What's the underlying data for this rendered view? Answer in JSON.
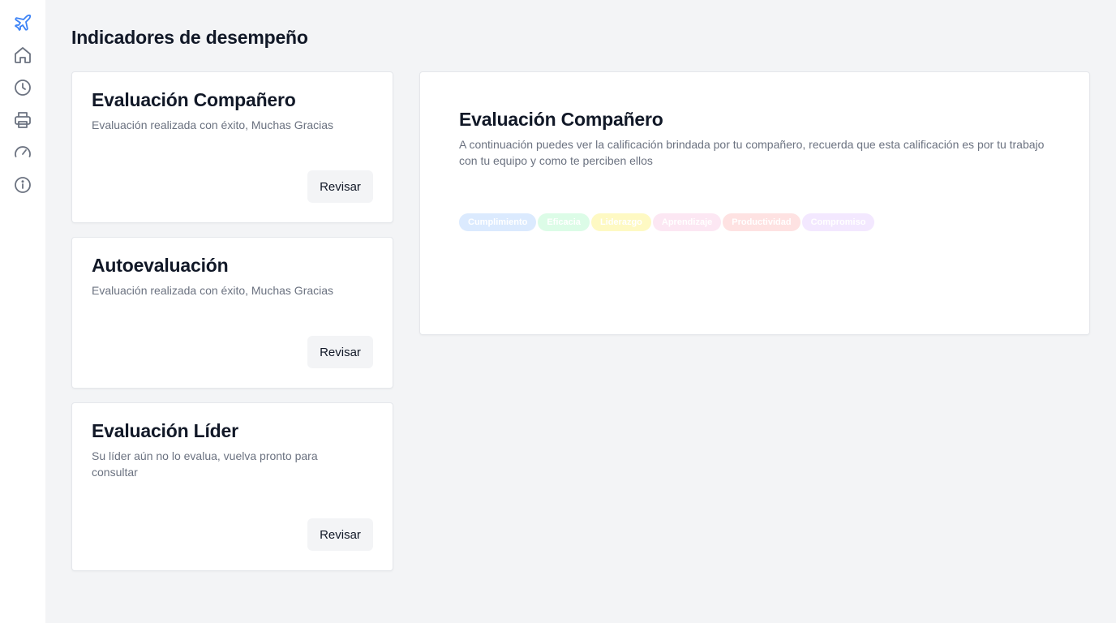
{
  "page": {
    "title": "Indicadores de desempeño"
  },
  "sidebar": {
    "items": [
      {
        "icon": "airplane-icon",
        "active": true
      },
      {
        "icon": "home-icon"
      },
      {
        "icon": "clock-icon"
      },
      {
        "icon": "printer-icon"
      },
      {
        "icon": "gauge-icon"
      },
      {
        "icon": "info-icon"
      }
    ],
    "active_color": "#3b82f6",
    "icon_color": "#6b7280"
  },
  "cards": [
    {
      "title": "Evaluación Compañero",
      "description": "Evaluación realizada con éxito, Muchas Gracias",
      "button_label": "Revisar"
    },
    {
      "title": "Autoevaluación",
      "description": "Evaluación realizada con éxito, Muchas Gracias",
      "button_label": "Revisar"
    },
    {
      "title": "Evaluación Líder",
      "description": "Su líder aún no lo evalua, vuelva pronto para consultar",
      "button_label": "Revisar"
    }
  ],
  "detail": {
    "title": "Evaluación Compañero",
    "description": "A continuación puedes ver la calificación brindada por tu compañero, recuerda que esta calificación es por tu trabajo con tu equipo y como te perciben ellos",
    "legend": [
      {
        "label": "Cumplimiento",
        "color": "#dbeafe"
      },
      {
        "label": "Eficacia",
        "color": "#dcfce7"
      },
      {
        "label": "Liderazgo",
        "color": "#fef9c3"
      },
      {
        "label": "Aprendizaje",
        "color": "#fce7f3"
      },
      {
        "label": "Productividad",
        "color": "#fee2e2"
      },
      {
        "label": "Compromiso",
        "color": "#f3e8ff"
      }
    ]
  }
}
